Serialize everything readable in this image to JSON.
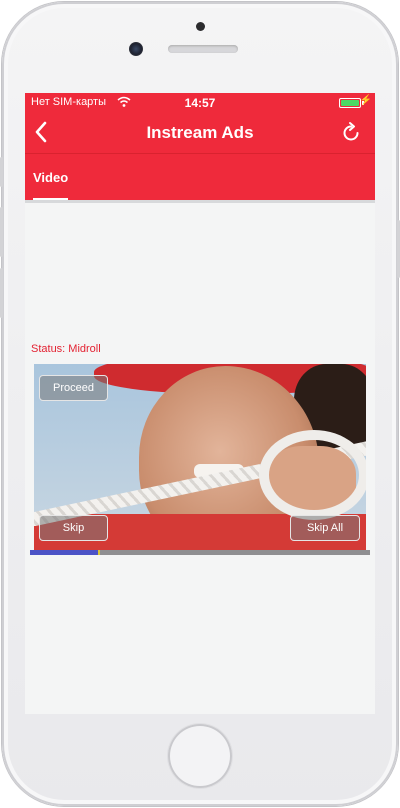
{
  "status_bar": {
    "carrier": "Нет SIM-карты",
    "time": "14:57",
    "battery_level": 1.0,
    "charging": true
  },
  "nav": {
    "title": "Instream Ads",
    "back_icon": "chevron-left-icon",
    "refresh_icon": "refresh-icon"
  },
  "tabs": [
    {
      "label": "Video",
      "selected": true
    }
  ],
  "status_label": "Status: Midroll",
  "player": {
    "proceed_label": "Proceed",
    "skip_label": "Skip",
    "skip_all_label": "Skip All",
    "progress": 0.2,
    "ad_marker": 0.2
  },
  "colors": {
    "accent": "#ef2a3b",
    "progress_fill": "#4b53c6",
    "status_text": "#e32232"
  }
}
